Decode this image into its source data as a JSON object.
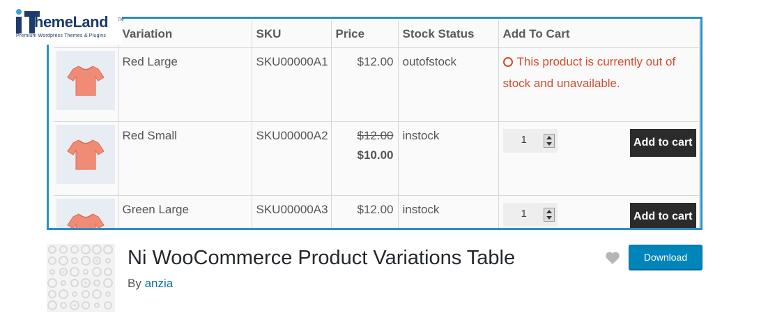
{
  "logo": {
    "brand": "hemeLand",
    "tagline": "Premium Wordpress Themes & Plugins",
    "mark": "iT"
  },
  "table": {
    "headers": [
      "",
      "Variation",
      "SKU",
      "Price",
      "Stock Status",
      "Add To Cart"
    ],
    "rows": [
      {
        "variation": "Red Large",
        "sku": "SKU00000A1",
        "price": "$12.00",
        "stock": "outofstock",
        "cart_message": "This product is currently out of stock and unavailable."
      },
      {
        "variation": "Red Small",
        "sku": "SKU00000A2",
        "regular_price": "$12.00",
        "sale_price": "$10.00",
        "stock": "instock",
        "qty": "1",
        "button": "Add to cart"
      },
      {
        "variation": "Green Large",
        "sku": "SKU00000A3",
        "price": "$12.00",
        "stock": "instock",
        "qty": "1",
        "button": "Add to cart"
      }
    ],
    "accent_color": "#2a8fc7",
    "error_color": "#d64b2c",
    "product_color": "#f08c76"
  },
  "plugin": {
    "title": "Ni WooCommerce Product Variations Table",
    "by_label": "By",
    "author": "anzia",
    "download_label": "Download",
    "favorite_icon": "heart-icon"
  }
}
